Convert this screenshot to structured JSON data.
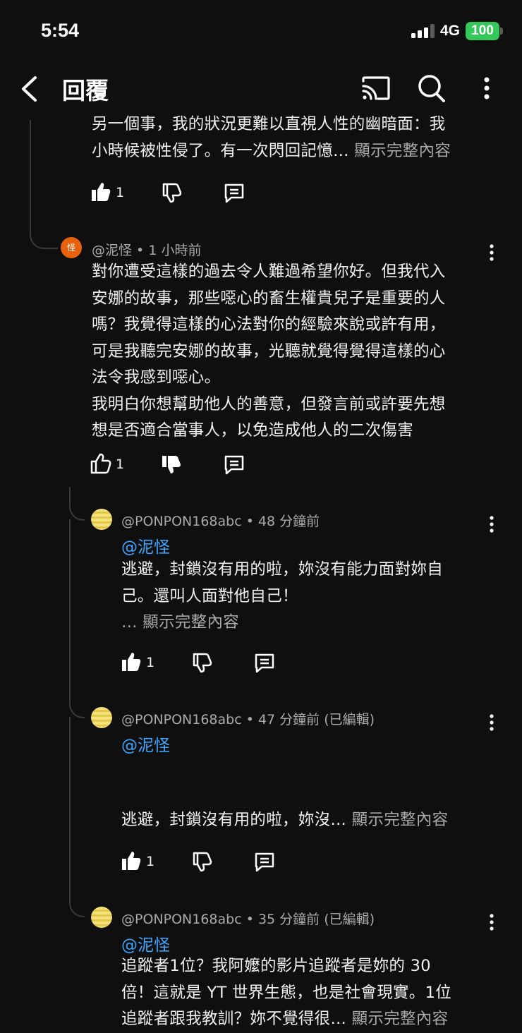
{
  "status": {
    "time": "5:54",
    "network": "4G",
    "battery": "100"
  },
  "appbar": {
    "title": "回覆"
  },
  "top_comment": {
    "line1": "另一個事，我的狀況更難以直視人性的幽暗面：我",
    "line2": "小時候被性侵了。有一次閃回記憶…",
    "more": "顯示完整內容",
    "likes": "1"
  },
  "comment1": {
    "avatar_letter": "怪",
    "author": "@泥怪",
    "time": "1 小時前",
    "lines": [
      "對你遭受這樣的過去令人難過希望你好。但我代入",
      "安娜的故事，那些噁心的畜生權貴兒子是重要的人",
      "嗎？我覺得這樣的心法對你的經驗來說或許有用，",
      "可是我聽完安娜的故事，光聽就覺得覺得這樣的心",
      "法令我感到噁心。",
      "我明白你想幫助他人的善意，但發言前或許要先想",
      "想是否適合當事人，以免造成他人的二次傷害"
    ],
    "likes": "1"
  },
  "reply1": {
    "author": "@PONPON168abc",
    "time": "48 分鐘前",
    "mention": "@泥怪",
    "line1": "逃避，封鎖沒有用的啦，妳沒有能力面對妳自",
    "line2": "己。還叫人面對他自己！",
    "line3_prefix": "…",
    "more": "顯示完整內容",
    "likes": "1"
  },
  "reply2": {
    "author": "@PONPON168abc",
    "time": "47 分鐘前 (已編輯)",
    "mention": "@泥怪",
    "line1": "逃避，封鎖沒有用的啦，妳沒…",
    "more": "顯示完整內容",
    "likes": "1"
  },
  "reply3": {
    "author": "@PONPON168abc",
    "time": "35 分鐘前 (已編輯)",
    "mention": "@泥怪",
    "line1": "追蹤者1位？我阿嬤的影片追蹤者是妳的 30",
    "line2": "倍！這就是 YT 世界生態，也是社會現實。1位",
    "line3": "追蹤者跟我教訓？妳不覺得很…",
    "more": "顯示完整內容"
  },
  "colors": {
    "background": "#0f0f0f",
    "link": "#3ea6ff",
    "secondary_text": "#aaaaaa",
    "battery": "#34c759"
  }
}
